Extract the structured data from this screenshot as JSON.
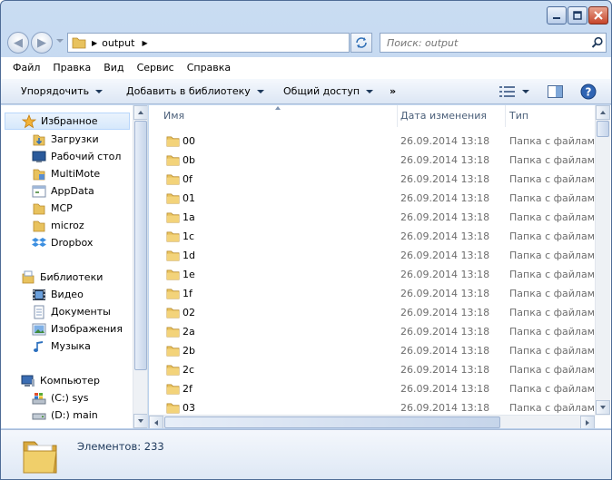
{
  "address": {
    "crumbs": [
      "output"
    ]
  },
  "search": {
    "placeholder": "Поиск: output"
  },
  "menu": [
    "Файл",
    "Правка",
    "Вид",
    "Сервис",
    "Справка"
  ],
  "toolbar": {
    "organize": "Упорядочить",
    "add_to_library": "Добавить в библиотеку",
    "share": "Общий доступ",
    "more": "»"
  },
  "nav": {
    "favorites": {
      "label": "Избранное",
      "items": [
        "Загрузки",
        "Рабочий стол",
        "MultiMote",
        "AppData",
        "MCP",
        "microz",
        "Dropbox"
      ]
    },
    "libraries": {
      "label": "Библиотеки",
      "items": [
        "Видео",
        "Документы",
        "Изображения",
        "Музыка"
      ]
    },
    "computer": {
      "label": "Компьютер",
      "items": [
        "(C:) sys",
        "(D:) main"
      ]
    }
  },
  "columns": {
    "name": "Имя",
    "date": "Дата изменения",
    "type": "Тип"
  },
  "files": [
    {
      "name": "00",
      "date": "26.09.2014 13:18",
      "type": "Папка с файлами"
    },
    {
      "name": "0b",
      "date": "26.09.2014 13:18",
      "type": "Папка с файлами"
    },
    {
      "name": "0f",
      "date": "26.09.2014 13:18",
      "type": "Папка с файлами"
    },
    {
      "name": "01",
      "date": "26.09.2014 13:18",
      "type": "Папка с файлами"
    },
    {
      "name": "1a",
      "date": "26.09.2014 13:18",
      "type": "Папка с файлами"
    },
    {
      "name": "1c",
      "date": "26.09.2014 13:18",
      "type": "Папка с файлами"
    },
    {
      "name": "1d",
      "date": "26.09.2014 13:18",
      "type": "Папка с файлами"
    },
    {
      "name": "1e",
      "date": "26.09.2014 13:18",
      "type": "Папка с файлами"
    },
    {
      "name": "1f",
      "date": "26.09.2014 13:18",
      "type": "Папка с файлами"
    },
    {
      "name": "02",
      "date": "26.09.2014 13:18",
      "type": "Папка с файлами"
    },
    {
      "name": "2a",
      "date": "26.09.2014 13:18",
      "type": "Папка с файлами"
    },
    {
      "name": "2b",
      "date": "26.09.2014 13:18",
      "type": "Папка с файлами"
    },
    {
      "name": "2c",
      "date": "26.09.2014 13:18",
      "type": "Папка с файлами"
    },
    {
      "name": "2f",
      "date": "26.09.2014 13:18",
      "type": "Папка с файлами"
    },
    {
      "name": "03",
      "date": "26.09.2014 13:18",
      "type": "Папка с файлами"
    }
  ],
  "status": {
    "items_count": "Элементов: 233"
  }
}
